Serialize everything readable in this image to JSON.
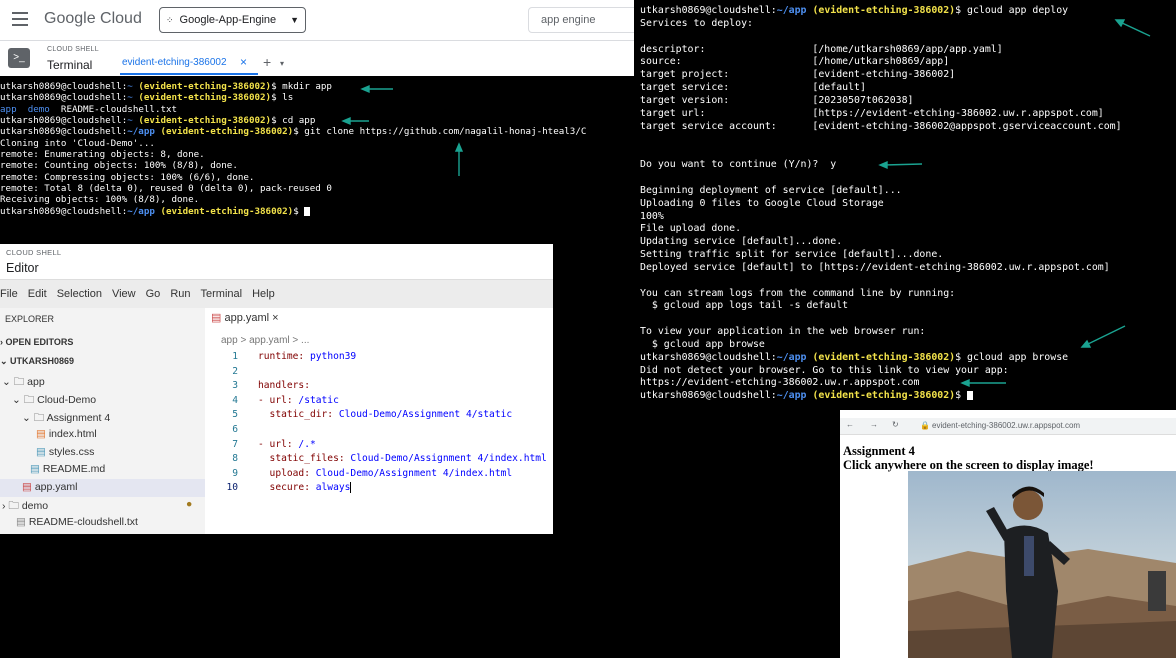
{
  "header": {
    "logo_text": "Google Cloud",
    "project": "Google-App-Engine",
    "search_value": "app engine"
  },
  "shell": {
    "kicker": "CLOUD SHELL",
    "title": "Terminal",
    "tab_label": "evident-etching-386002"
  },
  "terminal_a": {
    "user": "utkarsh0869@cloudshell:",
    "path_home": "~",
    "path_app": "~/app",
    "project": "(evident-etching-386002)",
    "cmd1": "$ mkdir app",
    "cmd2": "$ ls",
    "ls_app": "app",
    "ls_demo": "demo",
    "ls_readme": "README-cloudshell.txt",
    "cmd3": "$ cd app",
    "cmd4": "$ git clone https://github.com/nagalil-honaj-hteal3/C",
    "out1": "Cloning into 'Cloud-Demo'...",
    "out2": "remote: Enumerating objects: 8, done.",
    "out3": "remote: Counting objects: 100% (8/8), done.",
    "out4": "remote: Compressing objects: 100% (6/6), done.",
    "out5": "remote: Total 8 (delta 0), reused 0 (delta 0), pack-reused 0",
    "out6": "Receiving objects: 100% (8/8), done.",
    "prompt_end": "$ "
  },
  "editor": {
    "kicker": "CLOUD SHELL",
    "title": "Editor",
    "menu": [
      "File",
      "Edit",
      "Selection",
      "View",
      "Go",
      "Run",
      "Terminal",
      "Help"
    ],
    "explorer_title": "EXPLORER",
    "open_editors": "OPEN EDITORS",
    "root": "UTKARSH0869",
    "tree": {
      "app": "app",
      "cloud_demo": "Cloud-Demo",
      "assignment": "Assignment 4",
      "index": "index.html",
      "styles": "styles.css",
      "readme_md": "README.md",
      "app_yaml": "app.yaml",
      "demo": "demo",
      "readme_cs": "README-cloudshell.txt"
    },
    "tab": "app.yaml",
    "breadcrumb": "app  >  app.yaml  >  ...",
    "code": {
      "l1k": "runtime:",
      "l1v": " python39",
      "l3k": "handlers:",
      "l4k": "- url:",
      "l4v": " /static",
      "l5k": "  static_dir:",
      "l5v": " Cloud-Demo/Assignment 4/static",
      "l7k": "- url:",
      "l7v": " /.*",
      "l8k": "  static_files:",
      "l8v": " Cloud-Demo/Assignment 4/index.html",
      "l9k": "  upload:",
      "l9v": " Cloud-Demo/Assignment 4/index.html",
      "l10k": "  secure:",
      "l10v": " always"
    }
  },
  "terminal_c": {
    "user": "utkarsh0869@cloudshell:",
    "path_app": "~/app",
    "project": "(evident-etching-386002)",
    "cmd_deploy": "$ gcloud app deploy",
    "services": "Services to deploy:",
    "descriptor": "descriptor:                  [/home/utkarsh0869/app/app.yaml]",
    "source": "source:                      [/home/utkarsh0869/app]",
    "target_project": "target project:              [evident-etching-386002]",
    "target_service": "target service:              [default]",
    "target_version": "target version:              [20230507t062038]",
    "target_url": "target url:                  [https://evident-etching-386002.uw.r.appspot.com]",
    "target_account": "target service account:      [evident-etching-386002@appspot.gserviceaccount.com]",
    "continue": "Do you want to continue (Y/n)?  y",
    "begin": "Beginning deployment of service [default]...",
    "uploading": "Uploading 0 files to Google Cloud Storage",
    "pct": "100%",
    "upload_done": "File upload done.",
    "updating": "Updating service [default]...done.",
    "traffic": "Setting traffic split for service [default]...done.",
    "deployed": "Deployed service [default] to [https://evident-etching-386002.uw.r.appspot.com]",
    "stream": "You can stream logs from the command line by running:",
    "logs_cmd": "  $ gcloud app logs tail -s default",
    "view": "To view your application in the web browser run:",
    "browse_hint": "  $ gcloud app browse",
    "cmd_browse": "$ gcloud app browse",
    "no_browser": "Did not detect your browser. Go to this link to view your app:",
    "app_link": "https://evident-etching-386002.uw.r.appspot.com",
    "prompt_end": "$ "
  },
  "browser": {
    "url": "evident-etching-386002.uw.r.appspot.com",
    "heading1": "Assignment 4",
    "heading2": "Click anywhere on the screen to display image!"
  },
  "colors": {
    "accent_arrow": "#1aa391",
    "prompt_blue": "#4d8ff0",
    "project_yellow": "#f2e24a"
  }
}
